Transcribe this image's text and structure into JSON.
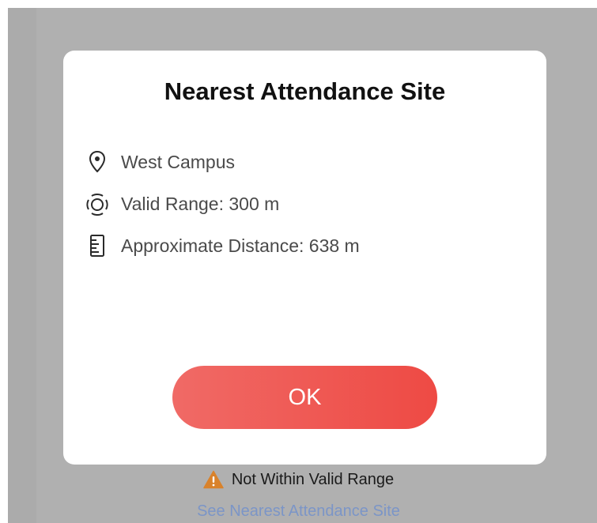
{
  "dialog": {
    "title": "Nearest Attendance Site",
    "rows": [
      {
        "icon": "location-pin-icon",
        "text": "West Campus"
      },
      {
        "icon": "range-signal-icon",
        "text": "Valid Range: 300 m"
      },
      {
        "icon": "ruler-icon",
        "text": "Approximate Distance: 638 m"
      }
    ],
    "ok_label": "OK"
  },
  "status": {
    "icon": "warning-icon",
    "text": "Not Within Valid Range",
    "warning_color": "#e0892c"
  },
  "link_text": "See Nearest Attendance Site",
  "colors": {
    "button": "#ee4a44",
    "link": "#7b95c7",
    "overlay": "#ababab"
  }
}
